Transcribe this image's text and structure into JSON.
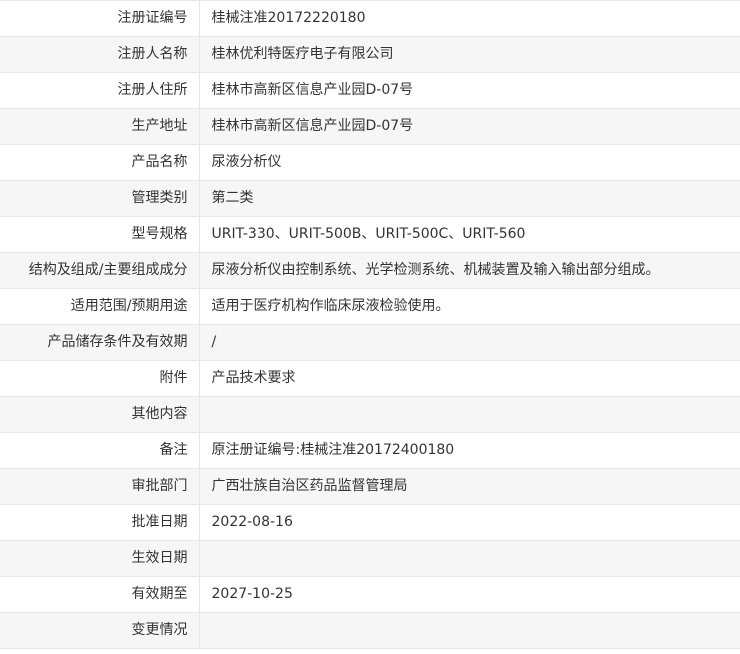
{
  "rows": [
    {
      "label": "注册证编号",
      "value": "桂械注准20172220180"
    },
    {
      "label": "注册人名称",
      "value": "桂林优利特医疗电子有限公司"
    },
    {
      "label": "注册人住所",
      "value": "桂林市高新区信息产业园D-07号"
    },
    {
      "label": "生产地址",
      "value": "桂林市高新区信息产业园D-07号"
    },
    {
      "label": "产品名称",
      "value": "尿液分析仪"
    },
    {
      "label": "管理类别",
      "value": "第二类"
    },
    {
      "label": "型号规格",
      "value": "URIT-330、URIT-500B、URIT-500C、URIT-560"
    },
    {
      "label": "结构及组成/主要组成成分",
      "value": "尿液分析仪由控制系统、光学检测系统、机械装置及输入输出部分组成。"
    },
    {
      "label": "适用范围/预期用途",
      "value": "适用于医疗机构作临床尿液检验使用。"
    },
    {
      "label": "产品储存条件及有效期",
      "value": "/"
    },
    {
      "label": "附件",
      "value": "产品技术要求"
    },
    {
      "label": "其他内容",
      "value": ""
    },
    {
      "label": "备注",
      "value": "原注册证编号:桂械注准20172400180"
    },
    {
      "label": "审批部门",
      "value": "广西壮族自治区药品监督管理局"
    },
    {
      "label": "批准日期",
      "value": "2022-08-16"
    },
    {
      "label": "生效日期",
      "value": ""
    },
    {
      "label": "有效期至",
      "value": "2027-10-25"
    },
    {
      "label": "变更情况",
      "value": ""
    }
  ]
}
